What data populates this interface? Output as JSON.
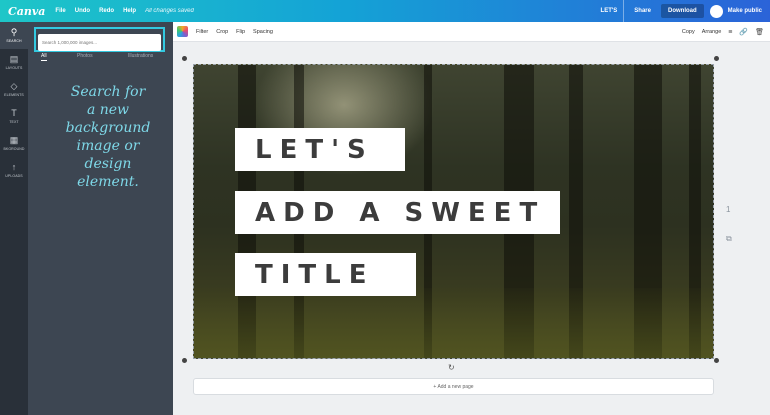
{
  "topbar": {
    "logo": "Canva",
    "menu": [
      "File",
      "Undo",
      "Redo",
      "Help"
    ],
    "saved_status": "All changes saved",
    "design_title": "LET'S",
    "share_label": "Share",
    "download_label": "Download",
    "public_label": "Make public"
  },
  "leftnav": {
    "items": [
      {
        "icon": "search-icon",
        "label": "SEARCH"
      },
      {
        "icon": "layouts-icon",
        "label": "LAYOUTS"
      },
      {
        "icon": "elements-icon",
        "label": "ELEMENTS"
      },
      {
        "icon": "text-icon",
        "label": "TEXT"
      },
      {
        "icon": "background-icon",
        "label": "BKGROUND"
      },
      {
        "icon": "upload-icon",
        "label": "UPLOADS"
      }
    ]
  },
  "panel": {
    "search_placeholder": "Search 1,000,000 images...",
    "tabs": [
      "All",
      "Photos",
      "Illustrations"
    ],
    "hint_lines": [
      "Search for",
      "a new",
      "background",
      "image or",
      "design",
      "element."
    ]
  },
  "toolbar": {
    "tools": [
      "Filter",
      "Crop",
      "Flip",
      "Spacing"
    ],
    "copy_label": "Copy",
    "arrange_label": "Arrange"
  },
  "design": {
    "title_lines": [
      "LET'S",
      "ADD A SWEET",
      "TITLE"
    ],
    "page_number": "1"
  },
  "add_page_label": "+ Add a new page",
  "colors": {
    "accent": "#33c9e0",
    "nav_bg": "#293039",
    "panel_bg": "#3d4652",
    "hint_text": "#7ed8e8"
  }
}
